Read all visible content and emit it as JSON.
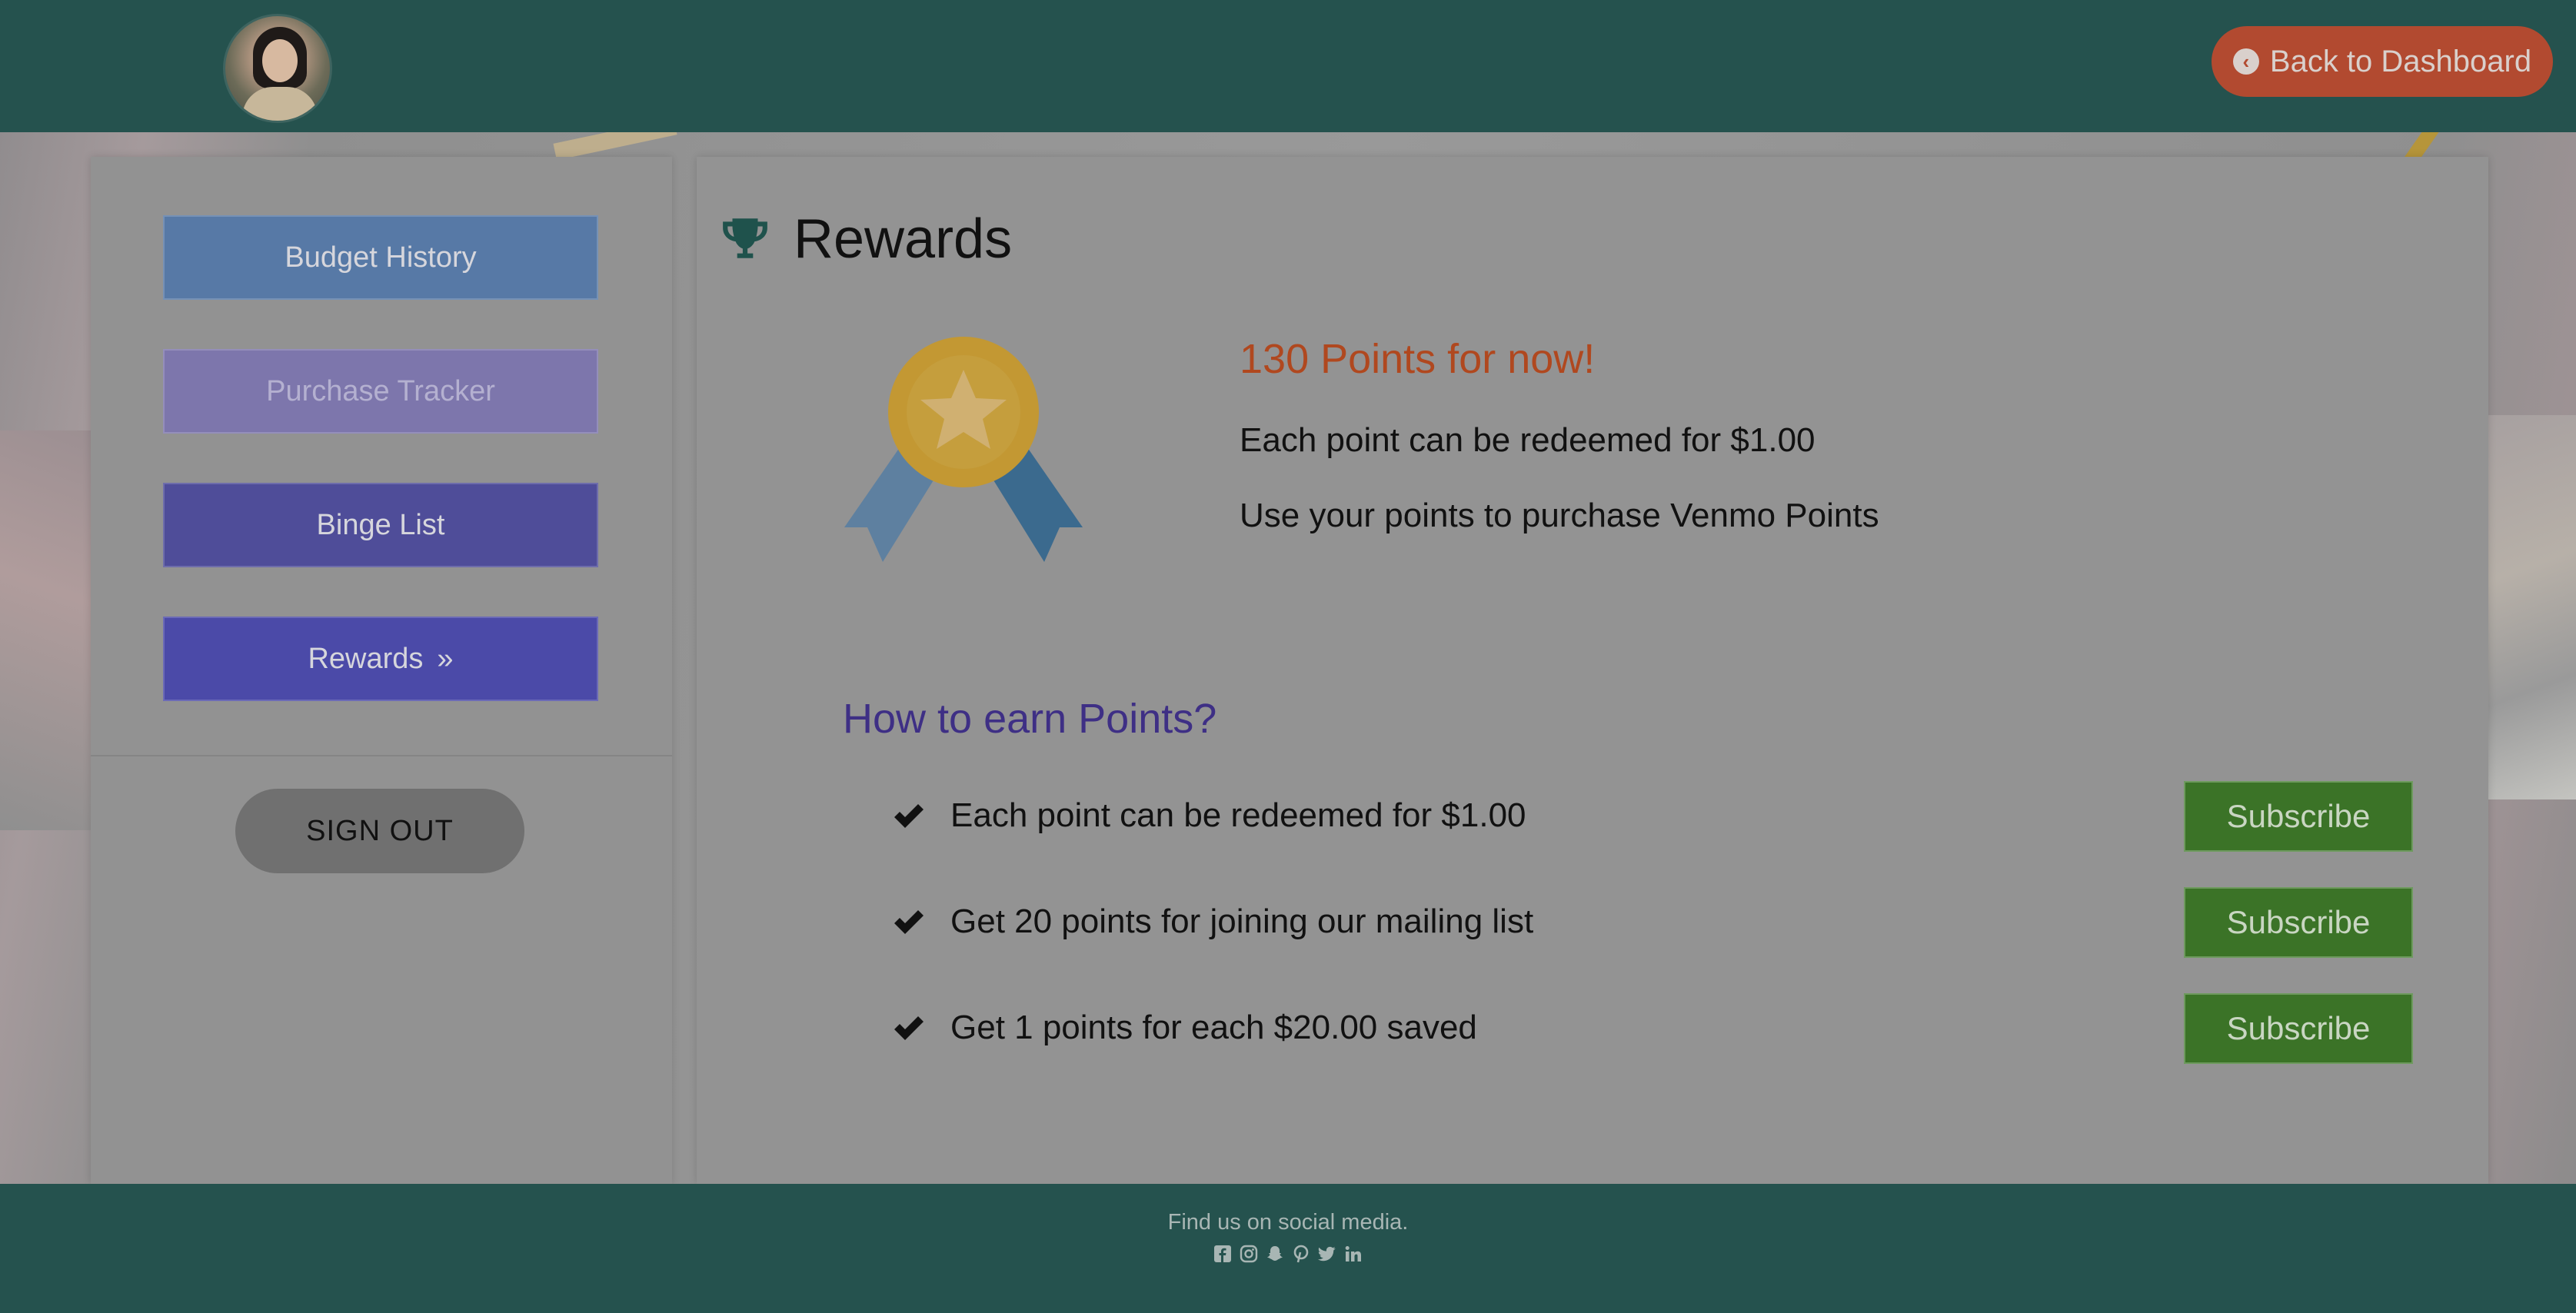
{
  "header": {
    "back_button_label": "Back to Dashboard"
  },
  "sidebar": {
    "items": [
      {
        "label": "Budget History"
      },
      {
        "label": "Purchase Tracker"
      },
      {
        "label": "Binge List"
      },
      {
        "label": "Rewards",
        "suffix": "»",
        "active": true
      }
    ],
    "signout_label": "SIGN OUT"
  },
  "main": {
    "title": "Rewards",
    "points_headline": "130 Points for now!",
    "points_line1": "Each point can be redeemed for $1.00",
    "points_line2": "Use your points to purchase Venmo Points",
    "earn_title": "How to earn Points?",
    "earn_items": [
      {
        "text": "Each point can be redeemed for $1.00",
        "button": "Subscribe"
      },
      {
        "text": "Get 20 points for joining our mailing list",
        "button": "Subscribe"
      },
      {
        "text": "Get 1 points for each $20.00 saved",
        "button": "Subscribe"
      }
    ]
  },
  "footer": {
    "text": "Find us on social media.",
    "social_icons": [
      "facebook-icon",
      "instagram-icon",
      "snapchat-icon",
      "pinterest-icon",
      "twitter-icon",
      "linkedin-icon"
    ]
  },
  "colors": {
    "header_bg": "#25524e",
    "back_button": "#b24a30",
    "points_headline": "#b0481f",
    "earn_title": "#3e2f85",
    "subscribe_button": "#3b7327"
  }
}
